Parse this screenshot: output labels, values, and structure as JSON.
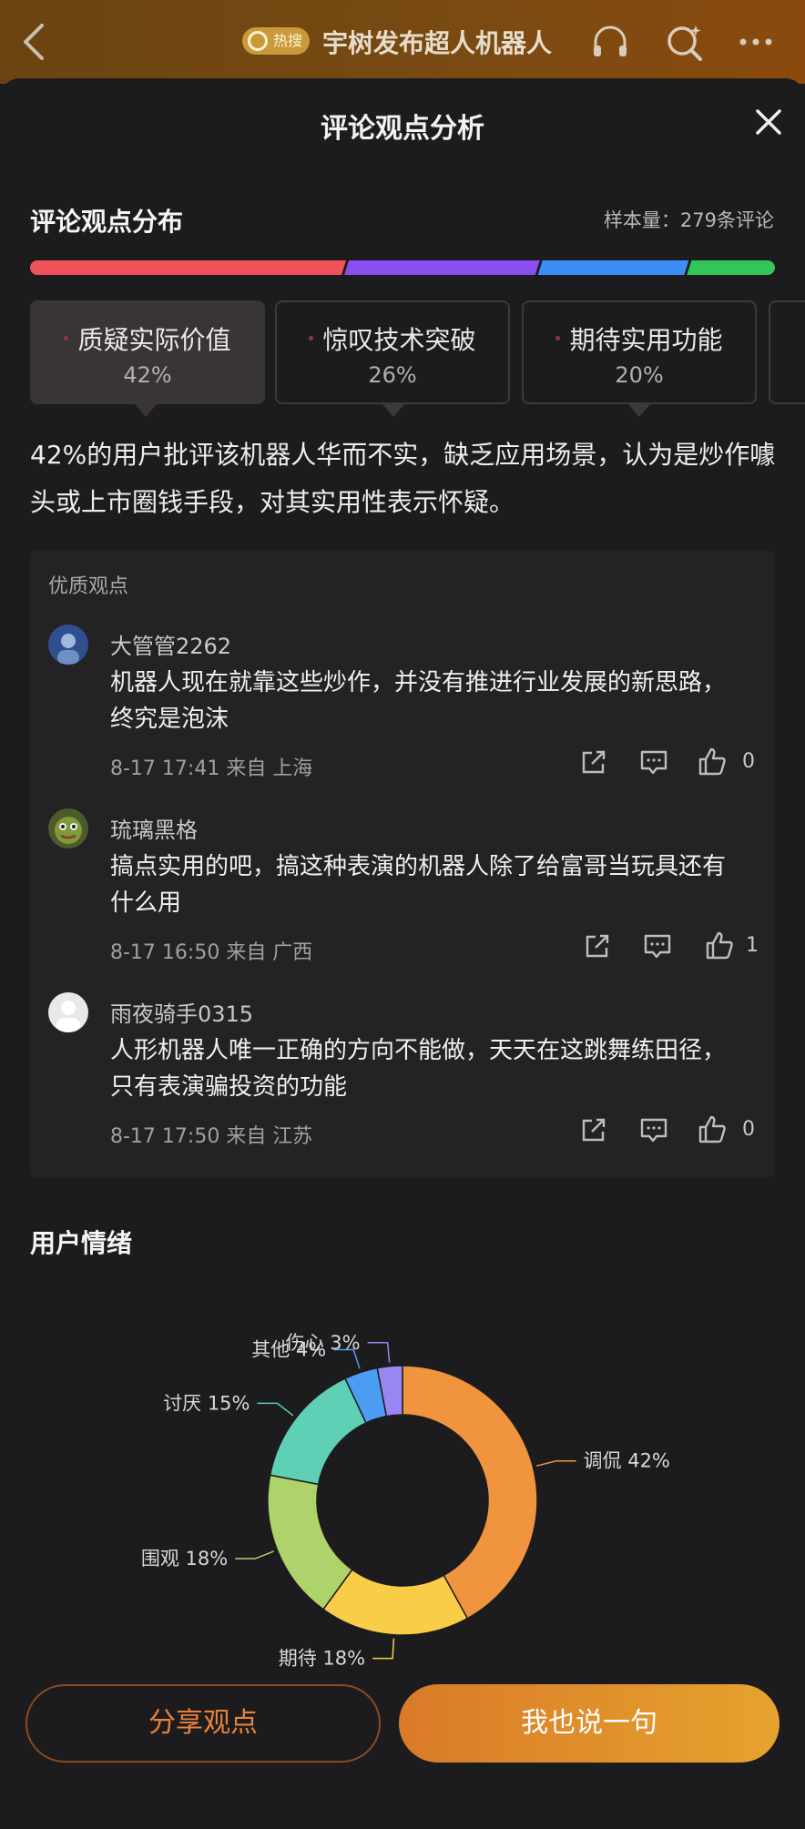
{
  "topbar": {
    "badge": "热搜",
    "title": "宇树发布超人机器人",
    "listen_icon": "listen-headphone-icon",
    "search_icon": "ai-search-icon",
    "more_icon": "more-dots-icon"
  },
  "sheet": {
    "title": "评论观点分析",
    "close_icon": "close-icon"
  },
  "distribution": {
    "title": "评论观点分布",
    "sample": "样本量：279条评论",
    "bar_segments": [
      {
        "label": "质疑实际价值",
        "percent": 42,
        "color": "#f0525a"
      },
      {
        "label": "惊叹技术突破",
        "percent": 26,
        "color": "#8a4df0"
      },
      {
        "label": "期待实用功能",
        "percent": 20,
        "color": "#3b8ef5"
      },
      {
        "label": "",
        "percent": 12,
        "color": "#33c45a"
      }
    ],
    "tabs": [
      {
        "label": "质疑实际价值",
        "pct": "42%",
        "active": true
      },
      {
        "label": "惊叹技术突破",
        "pct": "26%",
        "active": false
      },
      {
        "label": "期待实用功能",
        "pct": "20%",
        "active": false
      }
    ],
    "summary": "42%的用户批评该机器人华而不实，缺乏应用场景，认为是炒作噱头或上市圈钱手段，对其实用性表示怀疑。"
  },
  "quality": {
    "heading": "优质观点",
    "comments": [
      {
        "user": "大管管2262",
        "text": "机器人现在就靠这些炒作，并没有推进行业发展的新思路，终究是泡沫",
        "meta": "8-17 17:41 来自 上海",
        "likes": "0"
      },
      {
        "user": "琉璃黑格",
        "text": "搞点实用的吧，搞这种表演的机器人除了给富哥当玩具还有什么用",
        "meta": "8-17 16:50 来自 广西",
        "likes": "1"
      },
      {
        "user": "雨夜骑手0315",
        "text": "人形机器人唯一正确的方向不能做，天天在这跳舞练田径，只有表演骗投资的功能",
        "meta": "8-17 17:50 来自 江苏",
        "likes": "0"
      }
    ]
  },
  "emotion": {
    "title": "用户情绪"
  },
  "chart_data": {
    "type": "pie",
    "donut": true,
    "slices": [
      {
        "label": "调侃",
        "value": 42,
        "display": "调侃 42%",
        "color": "#f0953e"
      },
      {
        "label": "期待",
        "value": 18,
        "display": "期待 18%",
        "color": "#f9cd48"
      },
      {
        "label": "围观",
        "value": 18,
        "display": "围观 18%",
        "color": "#aed36a"
      },
      {
        "label": "讨厌",
        "value": 15,
        "display": "讨厌 15%",
        "color": "#5fcfb6"
      },
      {
        "label": "其他",
        "value": 4,
        "display": "其他 4%",
        "color": "#4a9df2"
      },
      {
        "label": "伤心",
        "value": 3,
        "display": "伤心 3%",
        "color": "#9a86f0"
      }
    ]
  },
  "actions": {
    "share": "分享观点",
    "say": "我也说一句"
  }
}
